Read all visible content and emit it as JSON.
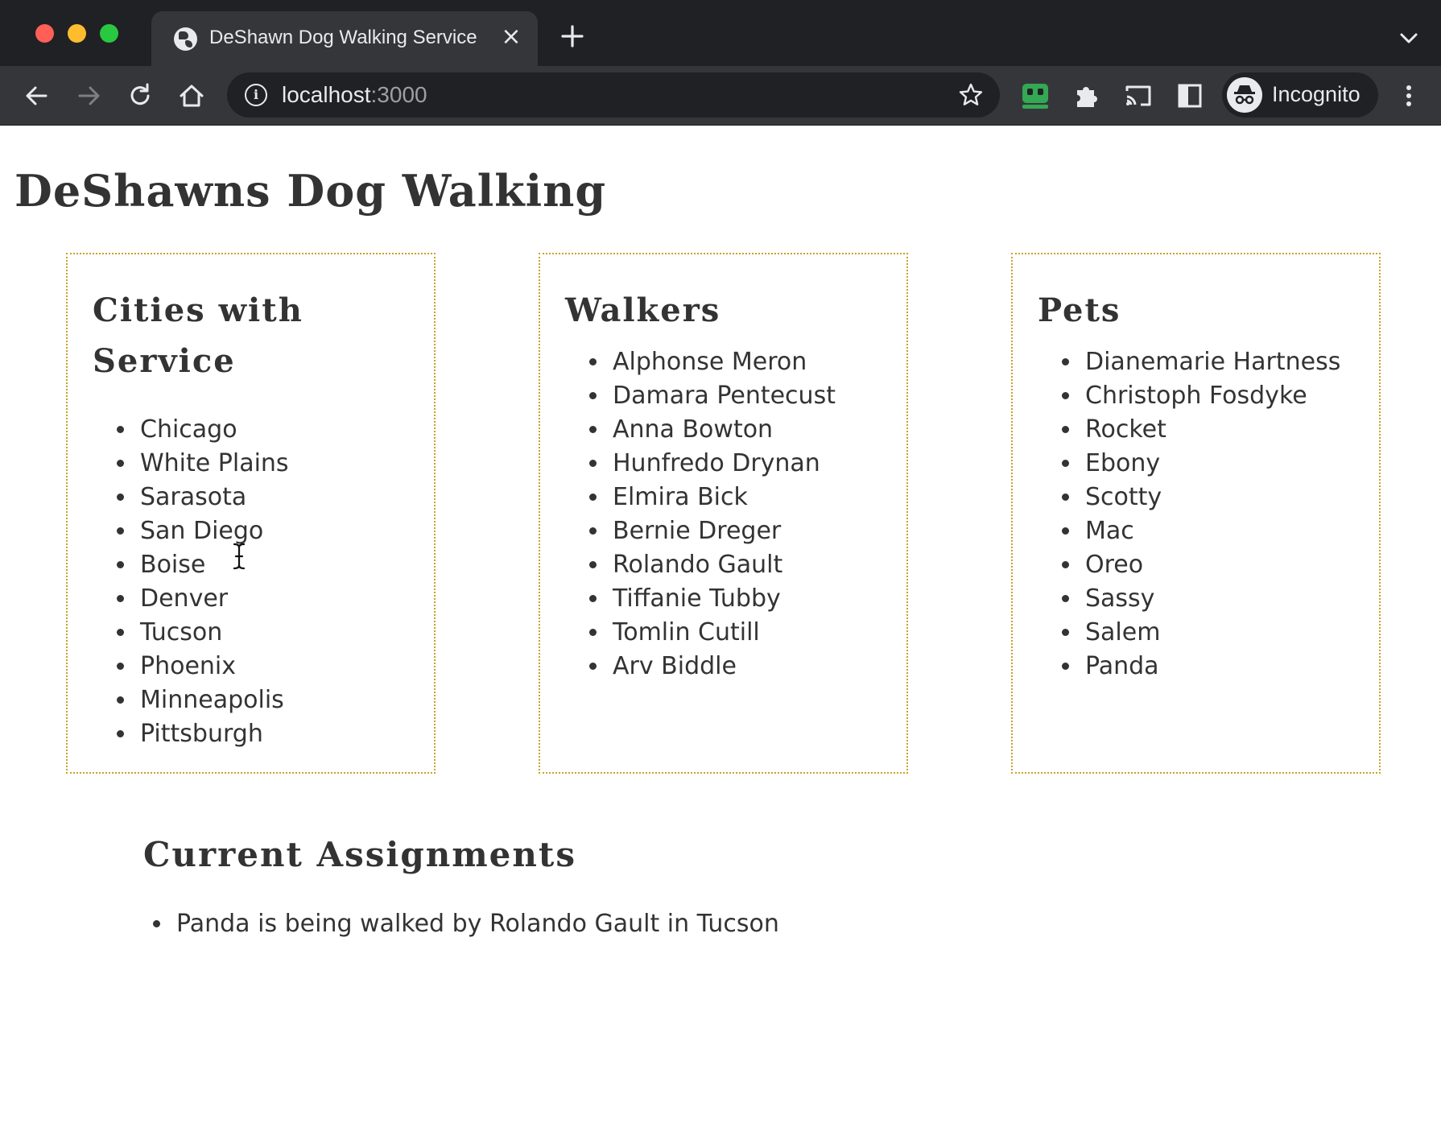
{
  "browser": {
    "tab_title": "DeShawn Dog Walking Service",
    "url_host": "localhost",
    "url_port": ":3000",
    "profile_label": "Incognito"
  },
  "page": {
    "title": "DeShawns Dog Walking",
    "cities": {
      "heading": "Cities with Service",
      "items": [
        "Chicago",
        "White Plains",
        "Sarasota",
        "San Diego",
        "Boise",
        "Denver",
        "Tucson",
        "Phoenix",
        "Minneapolis",
        "Pittsburgh"
      ]
    },
    "walkers": {
      "heading": "Walkers",
      "items": [
        "Alphonse Meron",
        "Damara Pentecust",
        "Anna Bowton",
        "Hunfredo Drynan",
        "Elmira Bick",
        "Bernie Dreger",
        "Rolando Gault",
        "Tiffanie Tubby",
        "Tomlin Cutill",
        "Arv Biddle"
      ]
    },
    "pets": {
      "heading": "Pets",
      "items": [
        "Dianemarie Hartness",
        "Christoph Fosdyke",
        "Rocket",
        "Ebony",
        "Scotty",
        "Mac",
        "Oreo",
        "Sassy",
        "Salem",
        "Panda"
      ]
    },
    "assignments": {
      "heading": "Current Assignments",
      "items": [
        "Panda is being walked by Rolando Gault in Tucson"
      ]
    }
  }
}
